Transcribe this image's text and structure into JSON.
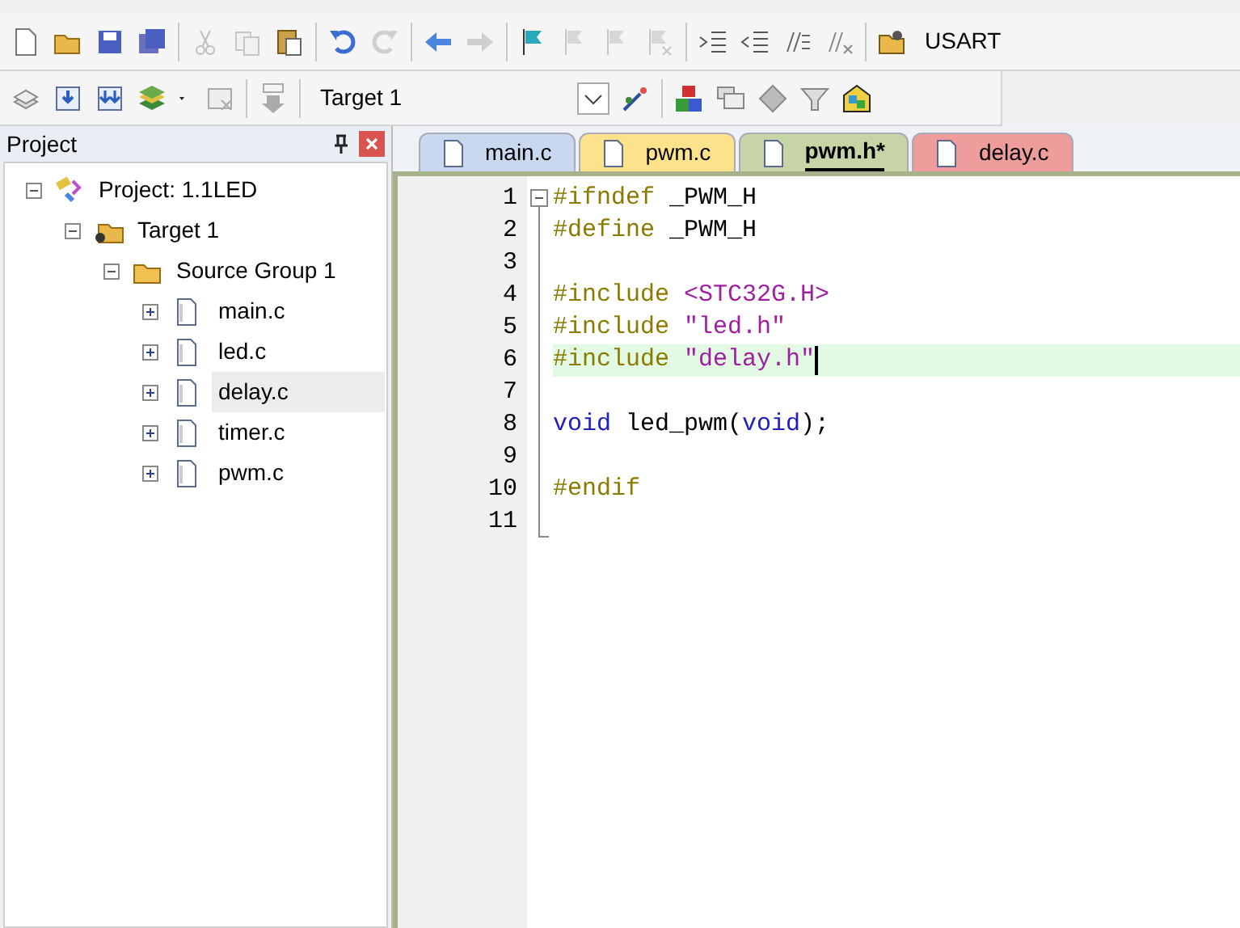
{
  "toolbar_1": {
    "groups": [
      [
        {
          "disabled": false
        },
        {
          "disabled": false
        },
        {
          "disabled": false
        },
        {
          "disabled": false
        }
      ],
      [
        {
          "disabled": true
        },
        {
          "disabled": true
        },
        {
          "disabled": false
        }
      ],
      [
        {
          "disabled": false
        },
        {
          "disabled": true
        }
      ],
      [
        {
          "disabled": false
        },
        {
          "disabled": true
        }
      ],
      [
        {
          "disabled": false
        },
        {
          "disabled": true
        },
        {
          "disabled": true
        },
        {
          "disabled": true
        }
      ],
      [
        {
          "disabled": false
        },
        {
          "disabled": false
        },
        {
          "disabled": false
        },
        {
          "disabled": false
        }
      ]
    ],
    "function_label": "USART"
  },
  "toolbar_2": {
    "target": "Target 1"
  },
  "project_panel": {
    "title": "Project",
    "tree": [
      {
        "label": "Project: 1.1LED",
        "kind": "project",
        "expanded": true,
        "selected": false,
        "children": [
          {
            "label": "Target 1",
            "kind": "target",
            "expanded": true,
            "selected": false,
            "children": [
              {
                "label": "Source Group 1",
                "kind": "group",
                "expanded": true,
                "selected": false,
                "children": [
                  {
                    "label": "main.c",
                    "kind": "file",
                    "expanded": false,
                    "selected": false
                  },
                  {
                    "label": "led.c",
                    "kind": "file",
                    "expanded": false,
                    "selected": false
                  },
                  {
                    "label": "delay.c",
                    "kind": "file",
                    "expanded": false,
                    "selected": true
                  },
                  {
                    "label": "timer.c",
                    "kind": "file",
                    "expanded": false,
                    "selected": false
                  },
                  {
                    "label": "pwm.c",
                    "kind": "file",
                    "expanded": false,
                    "selected": false
                  }
                ]
              }
            ]
          }
        ]
      }
    ]
  },
  "editor_tabs": [
    {
      "label": "main.c",
      "color": "#c9d7ef",
      "selected": false
    },
    {
      "label": "pwm.c",
      "color": "#fde28c",
      "selected": false
    },
    {
      "label": "pwm.h*",
      "color": "#c6d4a6",
      "selected": true
    },
    {
      "label": "delay.c",
      "color": "#ee9c9c",
      "selected": false
    }
  ],
  "code_lines": [
    {
      "number": "1",
      "current": false,
      "tokens": [
        {
          "kind": "preproc",
          "text": "#ifndef"
        },
        {
          "kind": "plain",
          "text": " _PWM_H"
        }
      ]
    },
    {
      "number": "2",
      "current": false,
      "tokens": [
        {
          "kind": "preproc",
          "text": "#define"
        },
        {
          "kind": "plain",
          "text": " _PWM_H"
        }
      ]
    },
    {
      "number": "3"
    },
    {
      "number": "4",
      "current": false,
      "tokens": [
        {
          "kind": "preproc",
          "text": "#include"
        },
        {
          "kind": "string",
          "text": " <STC32G.H>"
        }
      ]
    },
    {
      "number": "5",
      "current": false,
      "tokens": [
        {
          "kind": "preproc",
          "text": "#include"
        },
        {
          "kind": "string",
          "text": " \"led.h\""
        }
      ]
    },
    {
      "number": "6",
      "current": true,
      "tokens": [
        {
          "kind": "preproc",
          "text": "#include"
        },
        {
          "kind": "string",
          "text": " \"delay.h\""
        }
      ]
    },
    {
      "number": "7"
    },
    {
      "number": "8",
      "current": false,
      "tokens": [
        {
          "kind": "keyword",
          "text": "void"
        },
        {
          "kind": "plain",
          "text": " led_pwm("
        },
        {
          "kind": "keyword",
          "text": "void"
        },
        {
          "kind": "plain",
          "text": ");"
        }
      ]
    },
    {
      "number": "9"
    },
    {
      "number": "10",
      "current": false,
      "tokens": [
        {
          "kind": "preproc",
          "text": "#endif"
        }
      ]
    },
    {
      "number": "11"
    }
  ]
}
